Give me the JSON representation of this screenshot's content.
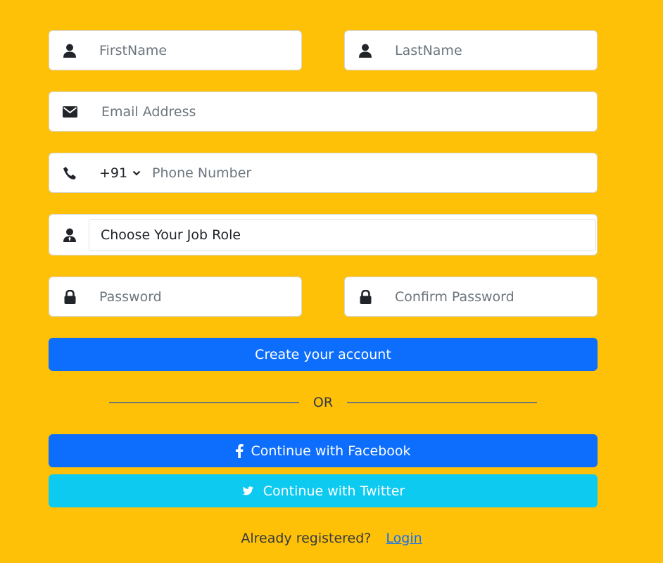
{
  "form": {
    "first_name": {
      "placeholder": "FirstName",
      "icon": "user-icon"
    },
    "last_name": {
      "placeholder": "LastName",
      "icon": "user-icon"
    },
    "email": {
      "placeholder": "Email Address",
      "icon": "envelope-icon"
    },
    "phone": {
      "country_code": "+91",
      "placeholder": "Phone Number",
      "icon": "phone-icon"
    },
    "job_role": {
      "selected": "Choose Your Job Role",
      "icon": "user-tie-icon"
    },
    "password": {
      "placeholder": "Password",
      "icon": "lock-icon"
    },
    "confirm_password": {
      "placeholder": "Confirm Password",
      "icon": "lock-icon"
    }
  },
  "actions": {
    "create_account_label": "Create your account",
    "divider_text": "OR",
    "facebook_label": "Continue with Facebook",
    "twitter_label": "Continue with Twitter"
  },
  "footer": {
    "prompt": "Already registered?",
    "login_label": "Login"
  },
  "colors": {
    "background": "#FFC107",
    "primary": "#0D6EFD",
    "twitter": "#0DCAF0"
  }
}
